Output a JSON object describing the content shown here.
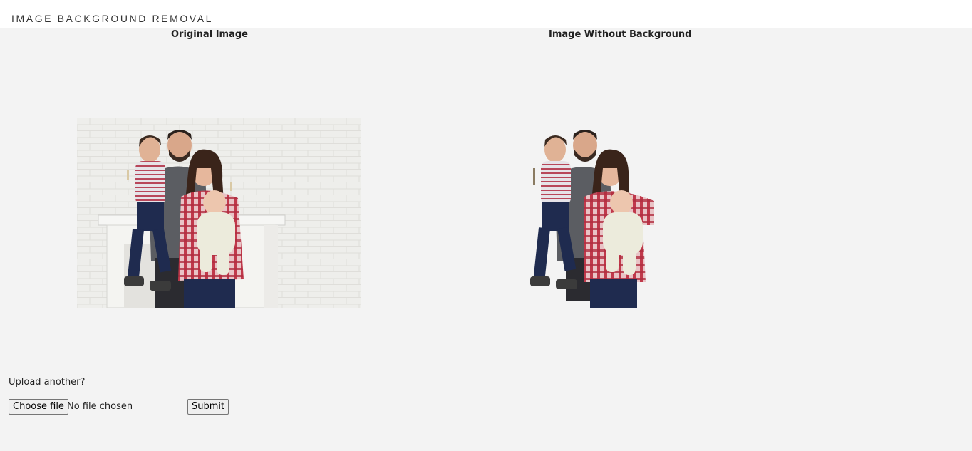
{
  "header": {
    "title": "IMAGE BACKGROUND REMOVAL"
  },
  "columns": {
    "original_title": "Original Image",
    "result_title": "Image Without Background"
  },
  "upload": {
    "prompt": "Upload another?",
    "choose_label": "Choose file",
    "status": "No file chosen",
    "submit_label": "Submit"
  },
  "colors": {
    "page_background": "#f3f3f3",
    "header_background": "#ffffff",
    "shirt_plaid_red": "#c0394b",
    "jeans_navy": "#1f2b4f",
    "sweater_gray": "#5b5d62"
  }
}
